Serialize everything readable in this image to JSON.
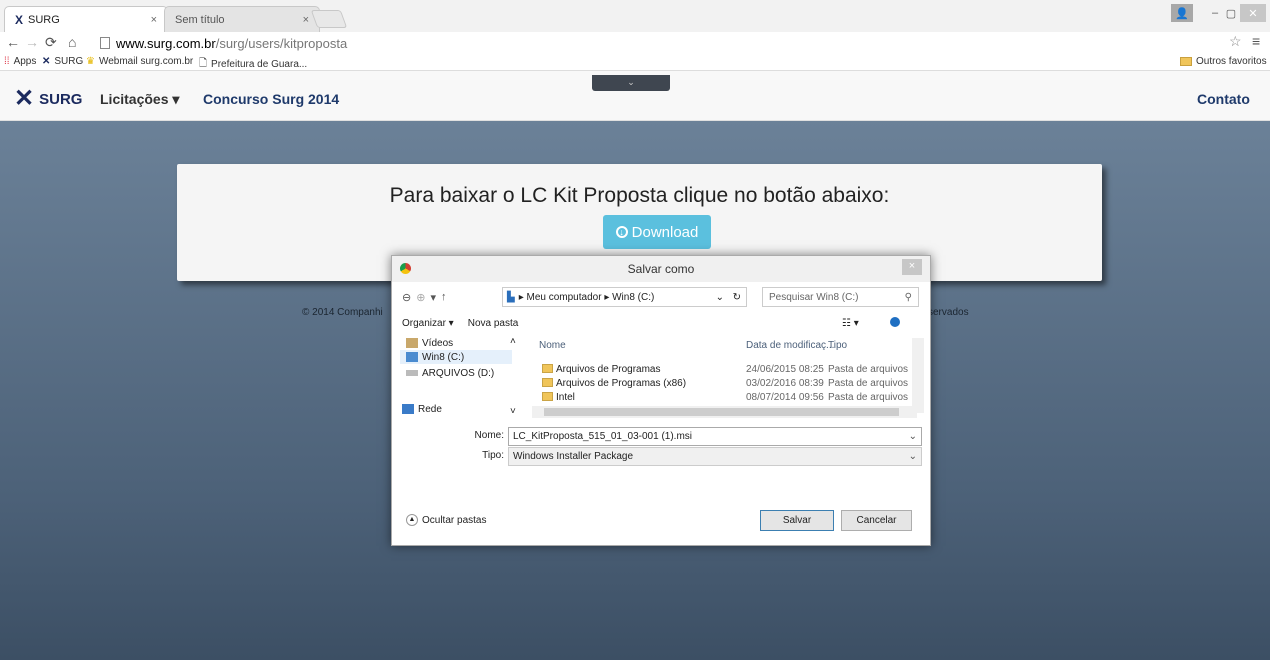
{
  "browser": {
    "tabs": [
      {
        "title": "SURG",
        "close": "×",
        "favicon": "X"
      },
      {
        "title": "Sem título",
        "close": "×"
      }
    ],
    "window_controls": {
      "minimize": "–",
      "maximize": "▢",
      "close": "✕"
    },
    "url_host": "www.surg.com.br",
    "url_path": "/surg/users/kitproposta",
    "bookmarks": [
      {
        "label": "Apps",
        "icon": "apps-grid-icon"
      },
      {
        "label": "SURG",
        "icon": "surg-logo-icon"
      },
      {
        "label": "Webmail surg.com.br",
        "icon": "crown-icon"
      },
      {
        "label": "Prefeitura de Guara...",
        "icon": "page-icon"
      }
    ],
    "other_bookmarks": "Outros favoritos"
  },
  "site": {
    "brand": "SURG",
    "nav": {
      "licitacoes": "Licitações ▾",
      "concurso": "Concurso Surg 2014",
      "contato": "Contato"
    },
    "handle_label": "⌄",
    "panel_heading": "Para baixar o LC Kit Proposta clique no botão abaixo:",
    "download_label": "Download",
    "footer_left": "© 2014 Companhi",
    "footer_right": "servados"
  },
  "dialog": {
    "title": "Salvar como",
    "close": "×",
    "breadcrumb": "▸ Meu computador ▸ Win8 (C:)",
    "search_placeholder": "Pesquisar Win8 (C:)",
    "organize": "Organizar ▾",
    "new_folder": "Nova pasta",
    "tree": [
      {
        "label": "Vídeos"
      },
      {
        "label": "Win8 (C:)",
        "selected": true
      },
      {
        "label": "ARQUIVOS (D:)"
      },
      {
        "label": "Rede"
      }
    ],
    "columns": {
      "name": "Nome",
      "date": "Data de modificaç...",
      "type": "Tipo"
    },
    "files": [
      {
        "name": "Arquivos de Programas",
        "date": "24/06/2015 08:25",
        "type": "Pasta de arquivos"
      },
      {
        "name": "Arquivos de Programas (x86)",
        "date": "03/02/2016 08:39",
        "type": "Pasta de arquivos"
      },
      {
        "name": "Intel",
        "date": "08/07/2014 09:56",
        "type": "Pasta de arquivos"
      }
    ],
    "name_label": "Nome:",
    "name_value": "LC_KitProposta_515_01_03-001 (1).msi",
    "type_label": "Tipo:",
    "type_value": "Windows Installer Package",
    "hide_folders": "Ocultar pastas",
    "save": "Salvar",
    "cancel": "Cancelar"
  }
}
